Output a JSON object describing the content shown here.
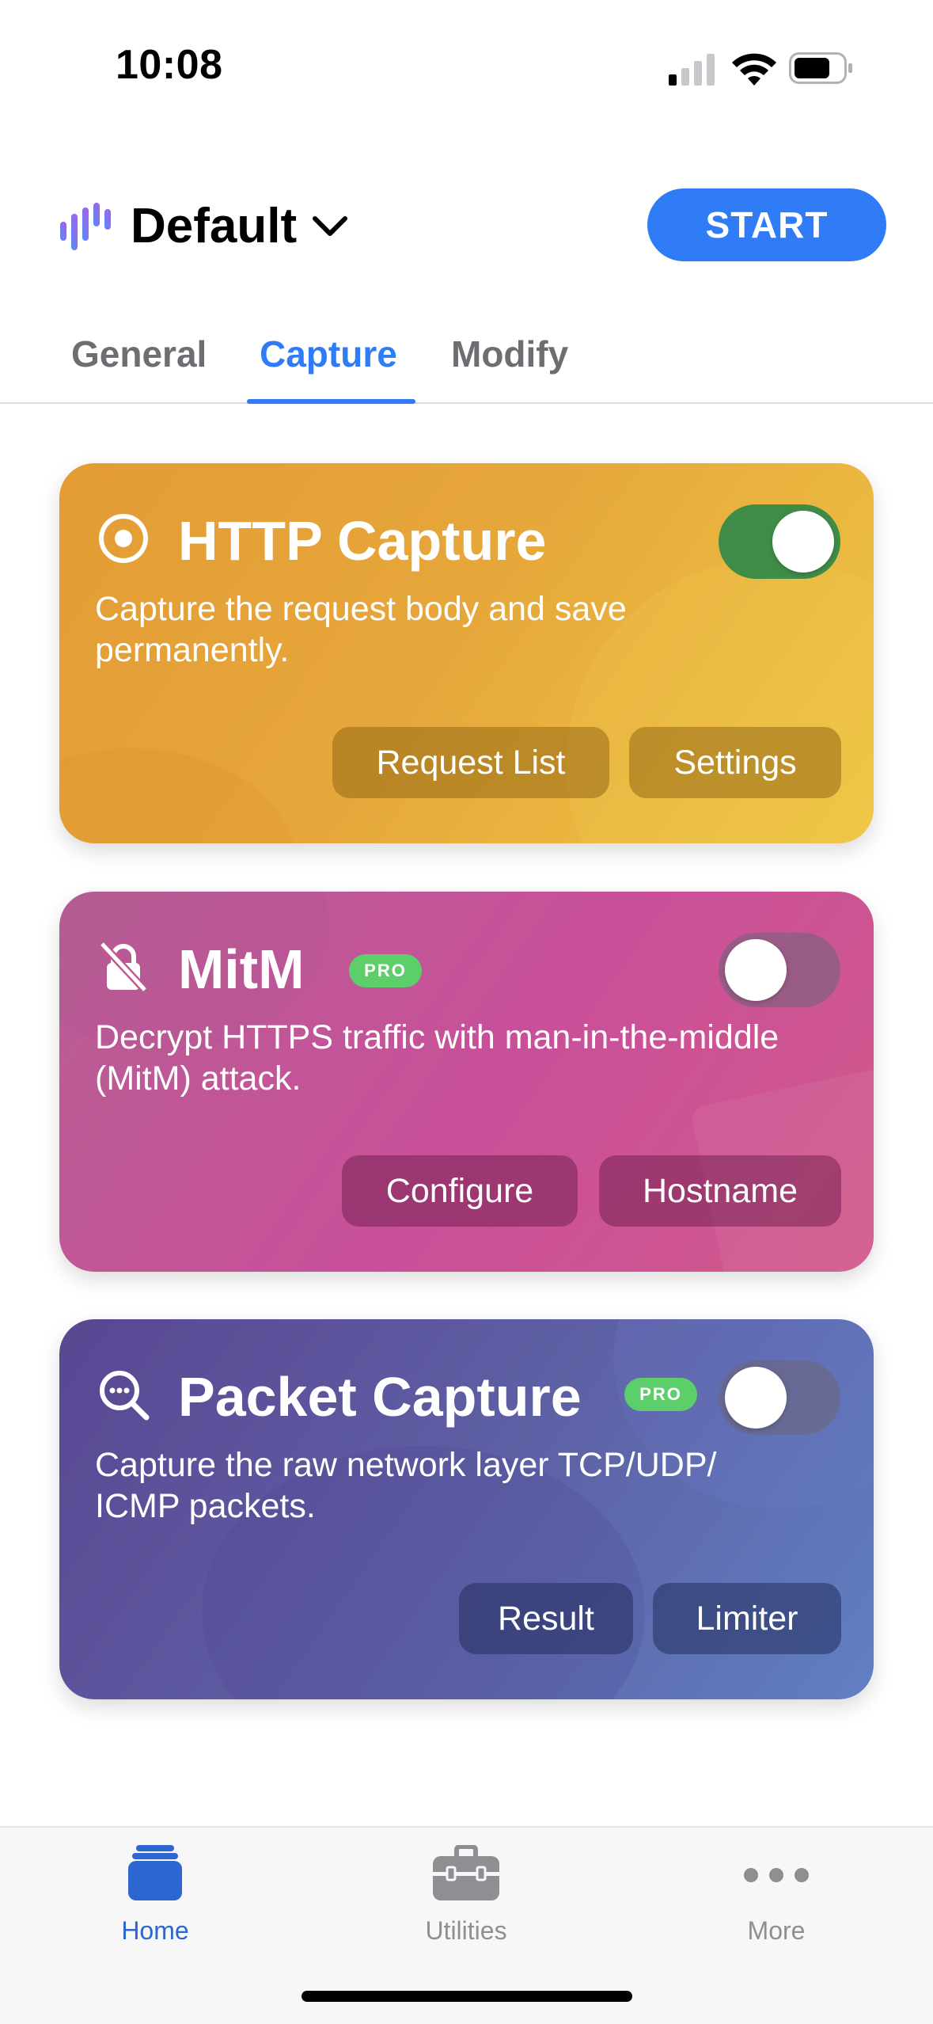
{
  "status_bar": {
    "time": "10:08",
    "icons": [
      "cellular-signal-icon",
      "wifi-icon",
      "battery-icon"
    ]
  },
  "header": {
    "logo_icon": "audio-bars-logo-icon",
    "profile_name": "Default",
    "dropdown_icon": "chevron-down-icon",
    "start_label": "START"
  },
  "tabs": [
    {
      "label": "General",
      "active": false
    },
    {
      "label": "Capture",
      "active": true
    },
    {
      "label": "Modify",
      "active": false
    }
  ],
  "cards": {
    "http_capture": {
      "icon": "target-icon",
      "title": "HTTP Capture",
      "description": "Capture the request body and save permanently.",
      "enabled": true,
      "buttons": [
        "Request List",
        "Settings"
      ]
    },
    "mitm": {
      "icon": "lock-slash-icon",
      "title": "MitM",
      "badge": "PRO",
      "description": "Decrypt HTTPS traffic with man-in-the-middle (MitM) attack.",
      "enabled": false,
      "buttons": [
        "Configure",
        "Hostname"
      ]
    },
    "packet_capture": {
      "icon": "magnifier-dots-icon",
      "title": "Packet Capture",
      "badge": "PRO",
      "description": "Capture the raw network layer TCP/UDP/ ICMP packets.",
      "enabled": false,
      "buttons": [
        "Result",
        "Limiter"
      ]
    }
  },
  "tab_bar": {
    "items": [
      {
        "label": "Home",
        "icon": "home-stack-icon",
        "active": true
      },
      {
        "label": "Utilities",
        "icon": "toolbox-icon",
        "active": false
      },
      {
        "label": "More",
        "icon": "ellipsis-icon",
        "active": false
      }
    ]
  },
  "colors": {
    "accent": "#2f7cf6",
    "toggle_on": "#3f8c47",
    "pro_badge": "#5ccf6a",
    "http_card": "#e6a63a",
    "mitm_card": "#c94f99",
    "packet_card": "#5e62a6"
  }
}
